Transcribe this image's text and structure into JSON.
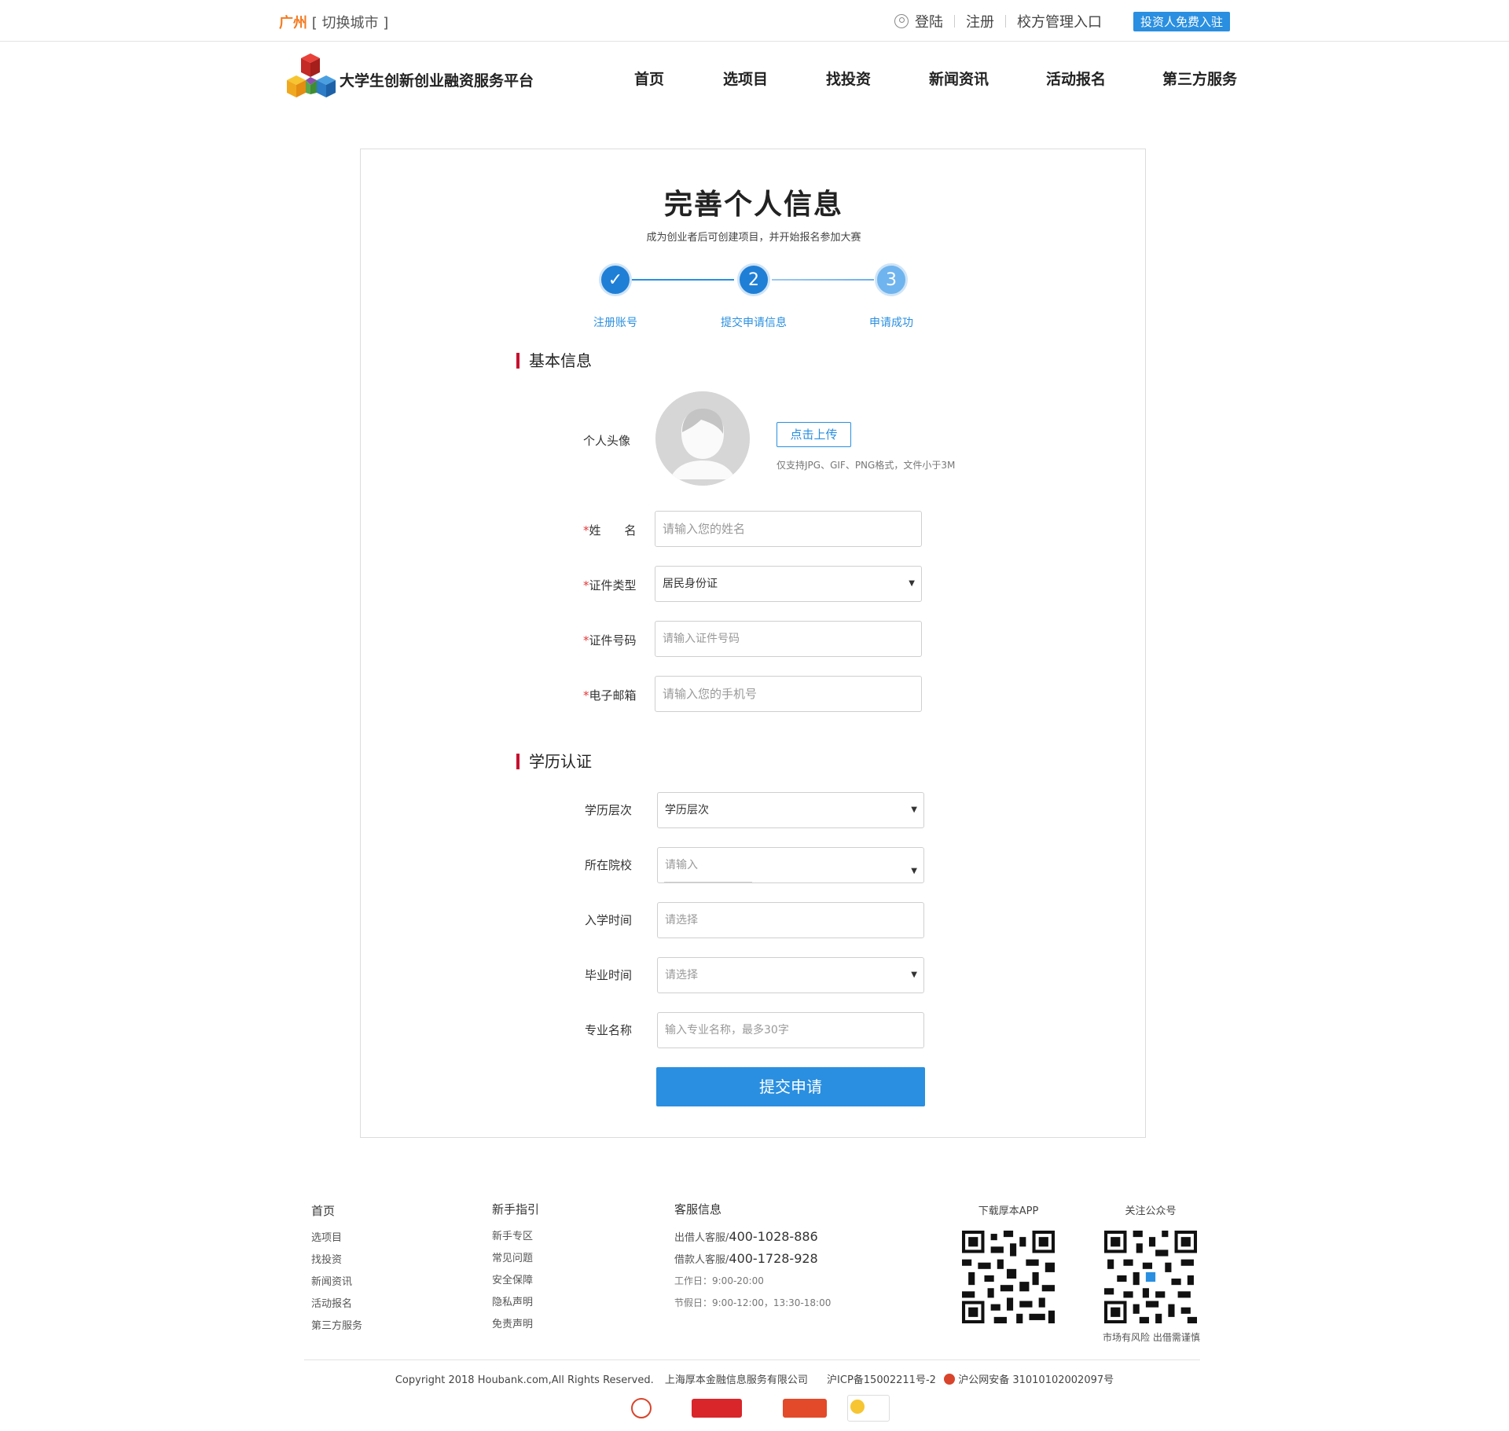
{
  "topbar": {
    "city": "广州",
    "switch_city": "[ 切换城市 ]",
    "login": "登陆",
    "register": "注册",
    "school_entry": "校方管理入口",
    "investor_button": "投资人免费入驻"
  },
  "header": {
    "brand": "大学生创新创业融资服务平台",
    "nav": [
      "首页",
      "选项目",
      "找投资",
      "新闻资讯",
      "活动报名",
      "第三方服务"
    ]
  },
  "form": {
    "title": "完善个人信息",
    "subtitle": "成为创业者后可创建项目，并开始报名参加大赛",
    "steps": [
      {
        "label": "注册账号",
        "symbol": "✓"
      },
      {
        "label": "提交申请信息",
        "symbol": "2"
      },
      {
        "label": "申请成功",
        "symbol": "3"
      }
    ],
    "section_basic": "基本信息",
    "avatar_label": "个人头像",
    "upload_button": "点击上传",
    "upload_hint": "仅支持JPG、GIF、PNG格式，文件小于3M",
    "required_mark": "*",
    "name_label": "姓　　名",
    "name_placeholder": "请输入您的姓名",
    "id_type_label": "证件类型",
    "id_type_value": "居民身份证",
    "id_number_label": "证件号码",
    "id_number_placeholder": "请输入证件号码",
    "email_label": "电子邮箱",
    "email_placeholder": "请输入您的手机号",
    "section_edu": "学历认证",
    "edu_level_label": "学历层次",
    "edu_level_value": "学历层次",
    "school_label": "所在院校",
    "school_placeholder": "请输入",
    "enroll_label": "入学时间",
    "enroll_placeholder": "请选择",
    "graduate_label": "毕业时间",
    "graduate_placeholder": "请选择",
    "major_label": "专业名称",
    "major_placeholder": "输入专业名称，最多30字",
    "submit": "提交申请",
    "dropdown_arrow": "▼"
  },
  "footer": {
    "col1": [
      "首页",
      "选项目",
      "找投资",
      "新闻资讯",
      "活动报名",
      "第三方服务"
    ],
    "col2_title": "新手指引",
    "col2": [
      "新手专区",
      "常见问题",
      "安全保障",
      "隐私声明",
      "免责声明"
    ],
    "service_title": "客服信息",
    "lender_label": "出借人客服/",
    "lender_phone": "400-1028-886",
    "borrower_label": "借款人客服/",
    "borrower_phone": "400-1728-928",
    "workday": "工作日：9:00-20:00",
    "holiday": "节假日：9:00-12:00，13:30-18:00",
    "app_title": "下载厚本APP",
    "wechat_title": "关注公众号",
    "risk": "市场有风险 出借需谨慎",
    "copyright": "Copyright 2018 Houbank.com,All Rights Reserved.",
    "company": "上海厚本金融信息服务有限公司",
    "icp": "沪ICP备15002211号-2",
    "police": "沪公网安备 31010102002097号"
  },
  "colors": {
    "accent": "#2a8fe0",
    "city": "#f47a20",
    "required": "#e4393c",
    "section_bar": "#c8102e"
  }
}
